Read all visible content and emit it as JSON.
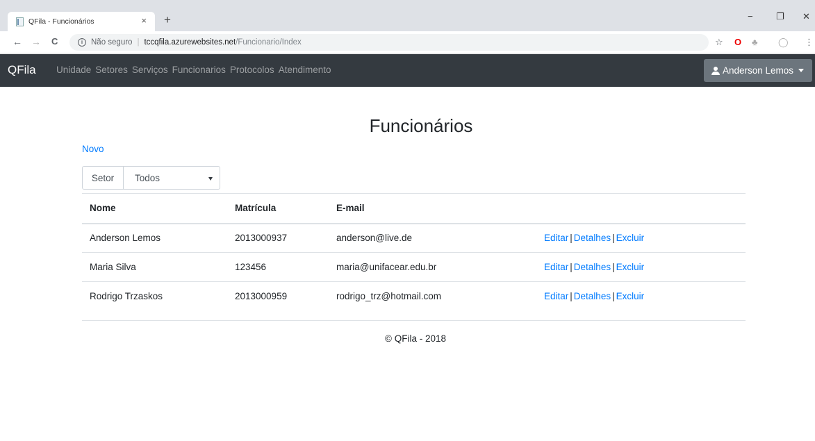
{
  "browser": {
    "tab_title": "QFila - Funcionários",
    "tab_close": "×",
    "new_tab": "+",
    "window_controls": {
      "minimize": "−",
      "restore": "❐",
      "close": "✕"
    },
    "nav": {
      "back": "←",
      "forward": "→",
      "reload": "C"
    },
    "address": {
      "info": "i",
      "security_text": "Não seguro",
      "separator": "|",
      "host": "tccqfila.azurewebsites.net",
      "path": "/Funcionario/Index"
    },
    "toolbar_icons": {
      "star": "☆",
      "opera": "O",
      "extension": "♣",
      "profile": "◯",
      "menu": "⋮"
    }
  },
  "navbar": {
    "brand": "QFila",
    "links": [
      "Unidade",
      "Setores",
      "Serviços",
      "Funcionarios",
      "Protocolos",
      "Atendimento"
    ],
    "user": "Anderson Lemos"
  },
  "page": {
    "title": "Funcionários",
    "new_link": "Novo",
    "filter": {
      "label": "Setor",
      "selected": "Todos"
    },
    "table": {
      "headers": [
        "Nome",
        "Matrícula",
        "E-mail",
        ""
      ],
      "rows": [
        {
          "nome": "Anderson Lemos",
          "matricula": "2013000937",
          "email": "anderson@live.de"
        },
        {
          "nome": "Maria Silva",
          "matricula": "123456",
          "email": "maria@unifacear.edu.br"
        },
        {
          "nome": "Rodrigo Trzaskos",
          "matricula": "2013000959",
          "email": "rodrigo_trz@hotmail.com"
        }
      ],
      "actions": {
        "edit": "Editar",
        "details": "Detalhes",
        "delete": "Excluir",
        "separator": "|"
      }
    },
    "footer": "© QFila - 2018"
  },
  "colors": {
    "navbar_bg": "#343a40",
    "link": "#007bff",
    "user_button": "#6c757d",
    "tabstrip": "#dee1e6"
  }
}
